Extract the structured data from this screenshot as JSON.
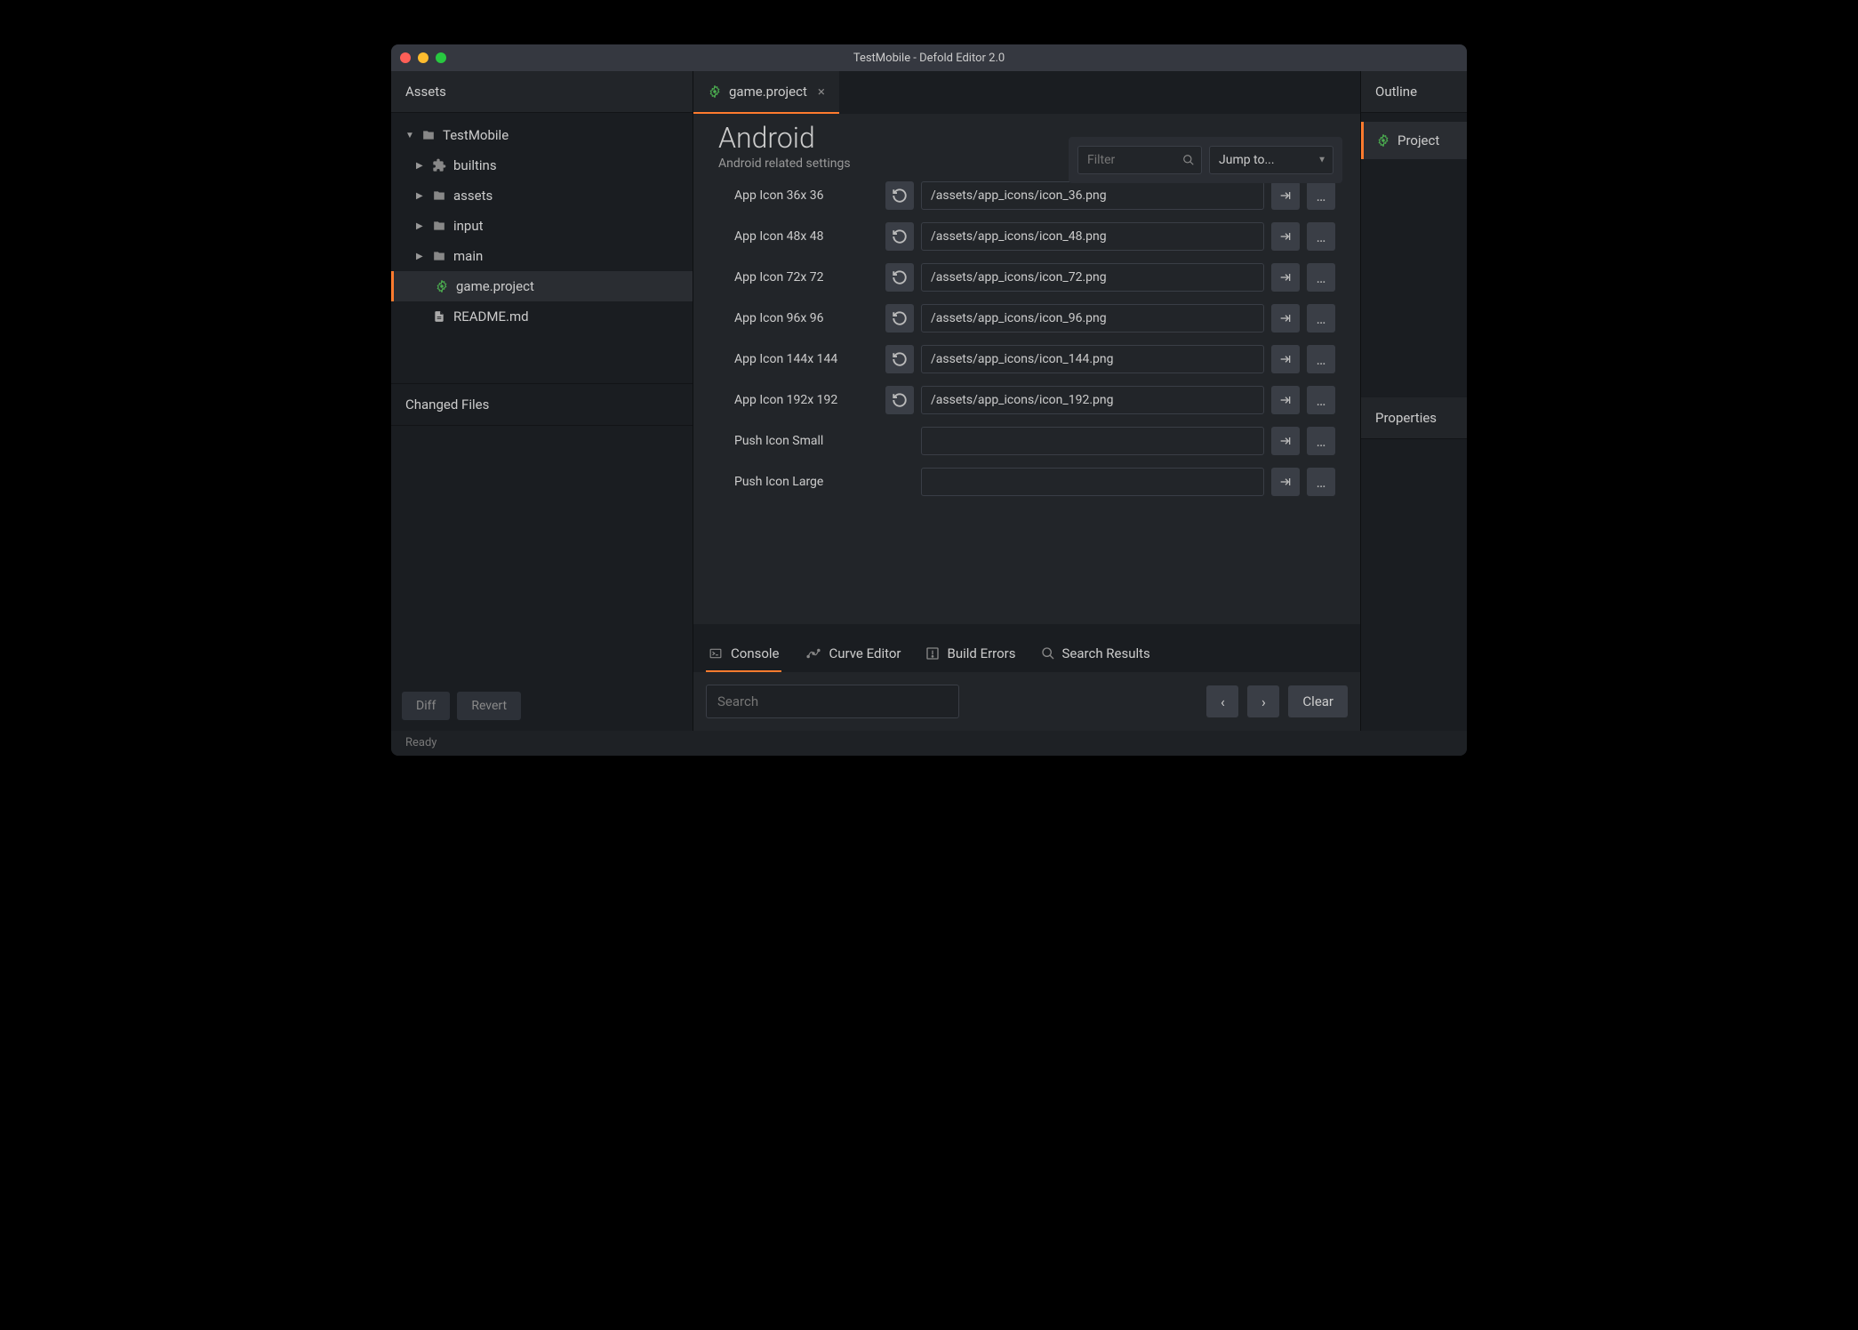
{
  "title": "TestMobile - Defold Editor 2.0",
  "left": {
    "assets_label": "Assets",
    "tree": [
      {
        "label": "TestMobile",
        "icon": "folder",
        "depth": 0,
        "arrow": "▼"
      },
      {
        "label": "builtins",
        "icon": "puzzle",
        "depth": 1,
        "arrow": "▶"
      },
      {
        "label": "assets",
        "icon": "folder",
        "depth": 1,
        "arrow": "▶"
      },
      {
        "label": "input",
        "icon": "folder",
        "depth": 1,
        "arrow": "▶"
      },
      {
        "label": "main",
        "icon": "folder",
        "depth": 1,
        "arrow": "▶"
      },
      {
        "label": "game.project",
        "icon": "gear",
        "depth": 1,
        "arrow": "",
        "sel": true
      },
      {
        "label": "README.md",
        "icon": "doc",
        "depth": 1,
        "arrow": ""
      }
    ],
    "changed_label": "Changed Files",
    "diff": "Diff",
    "revert": "Revert"
  },
  "tab": {
    "label": "game.project"
  },
  "form": {
    "heading": "Android",
    "sub": "Android related settings",
    "filter_ph": "Filter",
    "jump": "Jump to...",
    "rows": [
      {
        "label": "App Icon 36x 36",
        "value": "/assets/app_icons/icon_36.png",
        "reset": true
      },
      {
        "label": "App Icon 48x 48",
        "value": "/assets/app_icons/icon_48.png",
        "reset": true
      },
      {
        "label": "App Icon 72x 72",
        "value": "/assets/app_icons/icon_72.png",
        "reset": true
      },
      {
        "label": "App Icon 96x 96",
        "value": "/assets/app_icons/icon_96.png",
        "reset": true
      },
      {
        "label": "App Icon 144x 144",
        "value": "/assets/app_icons/icon_144.png",
        "reset": true
      },
      {
        "label": "App Icon 192x 192",
        "value": "/assets/app_icons/icon_192.png",
        "reset": true
      },
      {
        "label": "Push Icon Small",
        "value": "",
        "reset": false
      },
      {
        "label": "Push Icon Large",
        "value": "",
        "reset": false
      }
    ]
  },
  "bottom": {
    "tabs": [
      "Console",
      "Curve Editor",
      "Build Errors",
      "Search Results"
    ],
    "search_ph": "Search",
    "clear": "Clear"
  },
  "right": {
    "outline": "Outline",
    "project": "Project",
    "properties": "Properties"
  },
  "status": "Ready"
}
